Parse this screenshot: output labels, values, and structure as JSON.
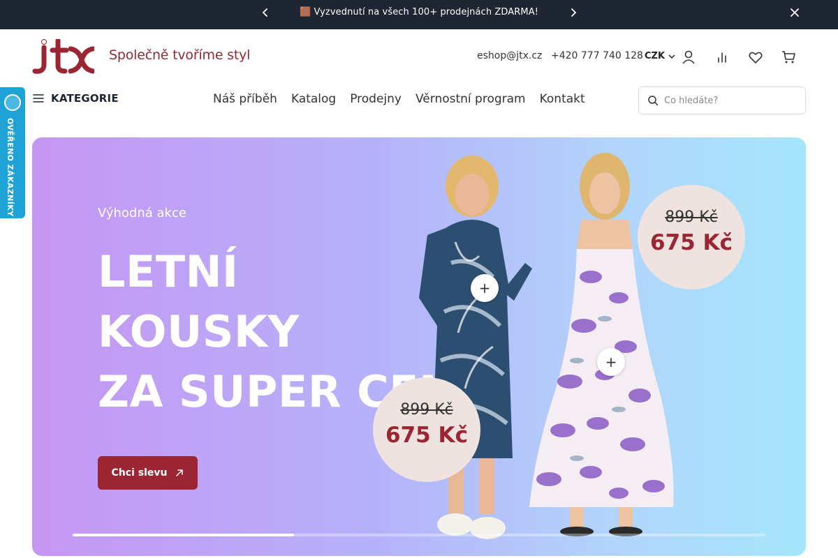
{
  "announcement": {
    "text": "🟫 Vyzvednutí na všech 100+ prodejnách ZDARMA!",
    "prev_icon": "chevron-left-icon",
    "next_icon": "chevron-right-icon",
    "close_icon": "close-icon"
  },
  "header": {
    "logo_text": "jtx",
    "tagline": "Společně tvoříme styl",
    "email": "eshop@jtx.cz",
    "phone": "+420 777 740 128",
    "currency": "CZK",
    "icons": [
      "user-icon",
      "compare-icon",
      "heart-icon",
      "cart-icon"
    ],
    "brand_color": "#9b2533"
  },
  "nav": {
    "categories_label": "KATEGORIE",
    "links": [
      "Náš příběh",
      "Katalog",
      "Prodejny",
      "Věrnostní program",
      "Kontakt"
    ],
    "search_placeholder": "Co hledáte?"
  },
  "side_badge": {
    "text": "OVĚŘENO ZÁKAZNÍKY",
    "color": "#1fa2d6"
  },
  "hero": {
    "eyebrow": "Výhodná akce",
    "headline_lines": [
      "LETNÍ",
      "KOUSKY",
      "ZA SUPER CENU"
    ],
    "cta_label": "Chci slevu",
    "cta_icon": "arrow-up-right-icon",
    "products": [
      {
        "old_price": "899 Kč",
        "new_price": "675 Kč"
      },
      {
        "old_price": "899 Kč",
        "new_price": "675 Kč"
      }
    ],
    "slide_progress": 0.32
  }
}
